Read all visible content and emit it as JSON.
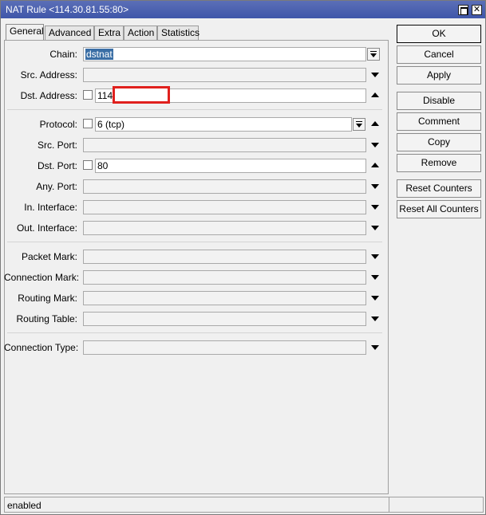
{
  "window": {
    "title": "NAT Rule <114.30.81.55:80>",
    "maximize_glyph": "",
    "close_glyph": "✕"
  },
  "tabs": [
    {
      "label": "General",
      "active": true
    },
    {
      "label": "Advanced",
      "active": false
    },
    {
      "label": "Extra",
      "active": false
    },
    {
      "label": "Action",
      "active": false
    },
    {
      "label": "Statistics",
      "active": false
    }
  ],
  "fields": {
    "chain": {
      "label": "Chain:",
      "value": "dstnat"
    },
    "src_address": {
      "label": "Src. Address:",
      "value": ""
    },
    "dst_address": {
      "label": "Dst. Address:",
      "value": "114"
    },
    "protocol": {
      "label": "Protocol:",
      "value": "6 (tcp)"
    },
    "src_port": {
      "label": "Src. Port:",
      "value": ""
    },
    "dst_port": {
      "label": "Dst. Port:",
      "value": "80"
    },
    "any_port": {
      "label": "Any. Port:",
      "value": ""
    },
    "in_interface": {
      "label": "In. Interface:",
      "value": ""
    },
    "out_interface": {
      "label": "Out. Interface:",
      "value": ""
    },
    "packet_mark": {
      "label": "Packet Mark:",
      "value": ""
    },
    "connection_mark": {
      "label": "Connection Mark:",
      "value": ""
    },
    "routing_mark": {
      "label": "Routing Mark:",
      "value": ""
    },
    "routing_table": {
      "label": "Routing Table:",
      "value": ""
    },
    "connection_type": {
      "label": "Connection Type:",
      "value": ""
    }
  },
  "buttons": {
    "ok": "OK",
    "cancel": "Cancel",
    "apply": "Apply",
    "disable": "Disable",
    "comment": "Comment",
    "copy": "Copy",
    "remove": "Remove",
    "reset_counters": "Reset Counters",
    "reset_all_counters": "Reset All Counters"
  },
  "status": {
    "text": "enabled"
  },
  "colors": {
    "titlebar": "#4a5fae",
    "selection": "#3a6ea5",
    "redaction_border": "#e0201d"
  }
}
